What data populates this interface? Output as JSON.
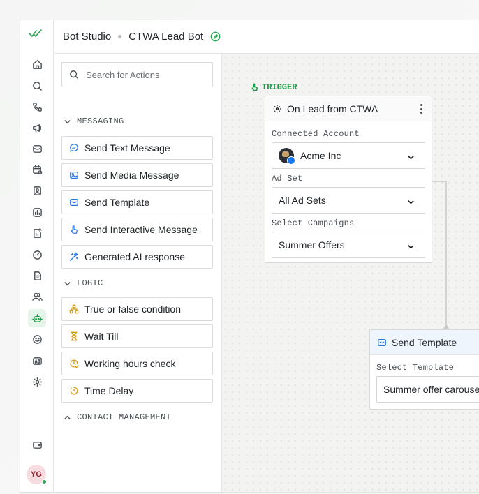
{
  "header": {
    "app_name": "Bot Studio",
    "bot_name": "CTWA Lead Bot"
  },
  "rail": {
    "icons": [
      "home-icon",
      "search-icon",
      "phone-icon",
      "megaphone-icon",
      "mail-icon",
      "calendar-icon",
      "contacts-icon",
      "report-icon",
      "analytics-icon",
      "gauge-icon",
      "document-icon",
      "users-icon",
      "bot-icon",
      "smile-icon",
      "ad-icon",
      "settings-icon"
    ],
    "bottom_icon": "wallet-icon",
    "avatar_initials": "YG"
  },
  "panel": {
    "search_placeholder": "Search for Actions",
    "sections": {
      "messaging": "MESSAGING",
      "logic": "LOGIC",
      "contact": "CONTACT MANAGEMENT"
    },
    "messaging_actions": [
      {
        "label": "Send Text Message",
        "icon": "chat-icon"
      },
      {
        "label": "Send Media Message",
        "icon": "image-icon"
      },
      {
        "label": "Send Template",
        "icon": "template-icon"
      },
      {
        "label": "Send Interactive Message",
        "icon": "hand-tap-icon"
      },
      {
        "label": "Generated AI response",
        "icon": "sparkle-icon"
      }
    ],
    "logic_actions": [
      {
        "label": "True or false condition",
        "icon": "branch-icon"
      },
      {
        "label": "Wait Till",
        "icon": "hourglass-icon"
      },
      {
        "label": "Working hours check",
        "icon": "clock-check-icon"
      },
      {
        "label": "Time Delay",
        "icon": "timer-icon"
      }
    ]
  },
  "canvas": {
    "trigger_tag": "TRIGGER",
    "trigger_node": {
      "title": "On Lead from CTWA",
      "connected_account_label": "Connected Account",
      "connected_account_value": "Acme Inc",
      "ad_set_label": "Ad Set",
      "ad_set_value": "All Ad Sets",
      "campaigns_label": "Select Campaigns",
      "campaigns_value": "Summer Offers"
    },
    "template_node": {
      "title": "Send Template",
      "select_label": "Select Template",
      "select_value": "Summer offer carousel"
    }
  },
  "colors": {
    "accent": "#1c9a4a",
    "active_bg": "#e5f5ea",
    "blue_icon": "#2c7be5",
    "amber_icon": "#d49b12"
  }
}
